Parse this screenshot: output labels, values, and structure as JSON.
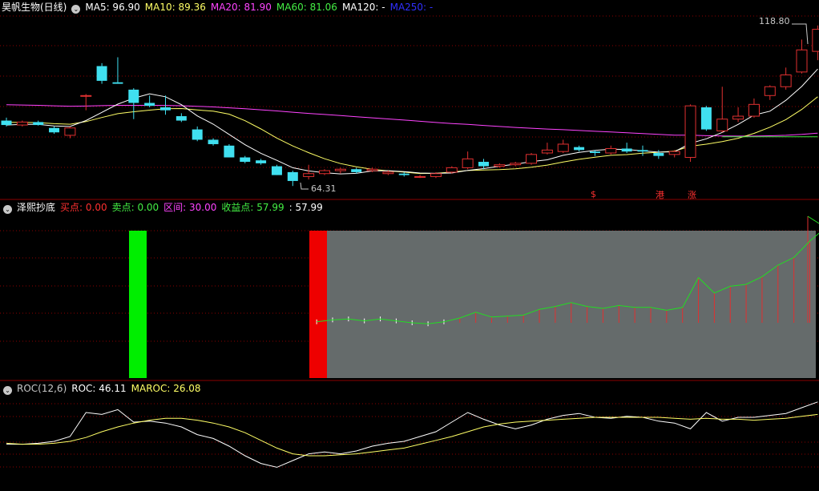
{
  "colors": {
    "bg": "#000000",
    "grid": "#8b0000",
    "up": "#e03030",
    "down": "#40e0f0",
    "ma5": "#ffffff",
    "ma10": "#ffff66",
    "ma20": "#ff44ff",
    "ma60": "#44ee44",
    "ma120": "#ffffff",
    "ma250": "#3030ff",
    "label": "#ff3030"
  },
  "main": {
    "stock": "昊帆生物(日线)",
    "ma5": "MA5: 96.90",
    "ma10": "MA10: 89.36",
    "ma20": "MA20: 81.90",
    "ma60": "MA60: 81.06",
    "ma120": "MA120: -",
    "ma250": "MA250: -",
    "high_label": "118.80",
    "low_label": "64.31",
    "markers": [
      "$",
      "港",
      "涨"
    ]
  },
  "indicator": {
    "name": "泽熙抄底",
    "buy": "买点: 0.00",
    "sell": "卖点: 0.00",
    "range": "区间: 30.00",
    "profit": "收益点: 57.99",
    "extra": ": 57.99"
  },
  "roc": {
    "name": "ROC(12,6)",
    "roc": "ROC: 46.11",
    "maroc": "MAROC: 26.08"
  },
  "chart_data": [
    {
      "type": "candlestick",
      "title": "昊帆生物(日线)",
      "ylim": [
        60,
        122
      ],
      "ohlc": [
        [
          86.5,
          87.5,
          84.5,
          85.0
        ],
        [
          85.0,
          86.5,
          84.5,
          86.0
        ],
        [
          86.0,
          86.5,
          84.8,
          85.0
        ],
        [
          84.0,
          84.5,
          82.0,
          82.5
        ],
        [
          81.5,
          84.5,
          80.5,
          84.0
        ],
        [
          95.0,
          95.5,
          90.0,
          95.0
        ],
        [
          105.0,
          106.0,
          99.0,
          100.0
        ],
        [
          99.5,
          108.0,
          99.0,
          99.0
        ],
        [
          97.0,
          97.5,
          87.0,
          92.5
        ],
        [
          92.5,
          95.0,
          91.0,
          91.5
        ],
        [
          91.0,
          95.0,
          88.5,
          90.0
        ],
        [
          88.0,
          89.0,
          86.0,
          86.5
        ],
        [
          83.5,
          84.5,
          79.5,
          80.0
        ],
        [
          80.0,
          80.5,
          78.0,
          78.5
        ],
        [
          78.0,
          78.5,
          74.0,
          74.0
        ],
        [
          74.0,
          74.5,
          72.0,
          72.5
        ],
        [
          73.0,
          73.5,
          71.5,
          72.0
        ],
        [
          71.0,
          71.5,
          68.0,
          68.0
        ],
        [
          69.0,
          69.5,
          64.3,
          66.0
        ],
        [
          67.5,
          71.5,
          66.5,
          68.5
        ],
        [
          68.5,
          70.0,
          68.0,
          69.5
        ],
        [
          69.5,
          70.5,
          68.5,
          70.0
        ],
        [
          70.0,
          70.5,
          68.5,
          69.0
        ],
        [
          69.5,
          70.5,
          69.0,
          70.0
        ],
        [
          68.5,
          69.5,
          68.0,
          69.0
        ],
        [
          68.5,
          69.0,
          67.5,
          68.0
        ],
        [
          67.5,
          68.0,
          67.0,
          67.5
        ],
        [
          67.5,
          69.0,
          67.0,
          68.5
        ],
        [
          69.0,
          71.0,
          68.5,
          70.5
        ],
        [
          70.5,
          76.0,
          70.0,
          73.5
        ],
        [
          72.5,
          73.5,
          70.0,
          71.0
        ],
        [
          71.0,
          72.0,
          70.5,
          71.5
        ],
        [
          71.5,
          72.5,
          71.0,
          72.0
        ],
        [
          72.0,
          75.5,
          71.5,
          75.0
        ],
        [
          75.5,
          79.0,
          75.0,
          76.5
        ],
        [
          76.0,
          80.0,
          75.5,
          78.5
        ],
        [
          77.5,
          78.0,
          76.0,
          76.5
        ],
        [
          76.0,
          76.5,
          74.5,
          75.5
        ],
        [
          75.5,
          78.0,
          75.0,
          77.0
        ],
        [
          77.0,
          79.0,
          75.5,
          76.0
        ],
        [
          76.5,
          78.0,
          74.5,
          76.0
        ],
        [
          75.5,
          76.5,
          73.5,
          74.5
        ],
        [
          75.0,
          76.5,
          74.0,
          76.0
        ],
        [
          74.0,
          92.0,
          72.5,
          91.5
        ],
        [
          91.0,
          91.5,
          83.0,
          83.5
        ],
        [
          83.0,
          98.0,
          82.5,
          87.0
        ],
        [
          87.0,
          91.0,
          86.0,
          88.0
        ],
        [
          88.0,
          94.0,
          87.5,
          92.0
        ],
        [
          95.0,
          98.5,
          93.5,
          98.0
        ],
        [
          98.0,
          104.5,
          97.0,
          102.0
        ],
        [
          103.0,
          114.0,
          102.5,
          110.5
        ],
        [
          110.0,
          118.8,
          107.0,
          117.5
        ]
      ]
    },
    {
      "type": "bar",
      "title": "泽熙抄底",
      "ylim": [
        0,
        100
      ]
    },
    {
      "type": "line",
      "title": "ROC(12,6)",
      "series": [
        {
          "name": "ROC",
          "values": [
            2,
            2,
            3,
            5,
            10,
            35,
            33,
            38,
            25,
            26,
            24,
            20,
            12,
            8,
            0,
            -10,
            -18,
            -22,
            -15,
            -8,
            -6,
            -8,
            -5,
            0,
            3,
            5,
            10,
            15,
            25,
            35,
            28,
            22,
            18,
            22,
            28,
            32,
            34,
            30,
            29,
            31,
            30,
            26,
            24,
            18,
            35,
            26,
            30,
            30,
            32,
            34,
            40,
            46
          ]
        },
        {
          "name": "MAROC",
          "values": [
            3,
            2,
            2,
            3,
            5,
            9,
            15,
            20,
            24,
            27,
            29,
            29,
            27,
            24,
            20,
            14,
            6,
            -2,
            -8,
            -10,
            -10,
            -9,
            -8,
            -6,
            -4,
            -2,
            2,
            6,
            10,
            15,
            20,
            23,
            25,
            26,
            27,
            28,
            29,
            30,
            30,
            30,
            30,
            30,
            29,
            28,
            29,
            28,
            28,
            27,
            28,
            29,
            31,
            33
          ]
        }
      ]
    }
  ]
}
